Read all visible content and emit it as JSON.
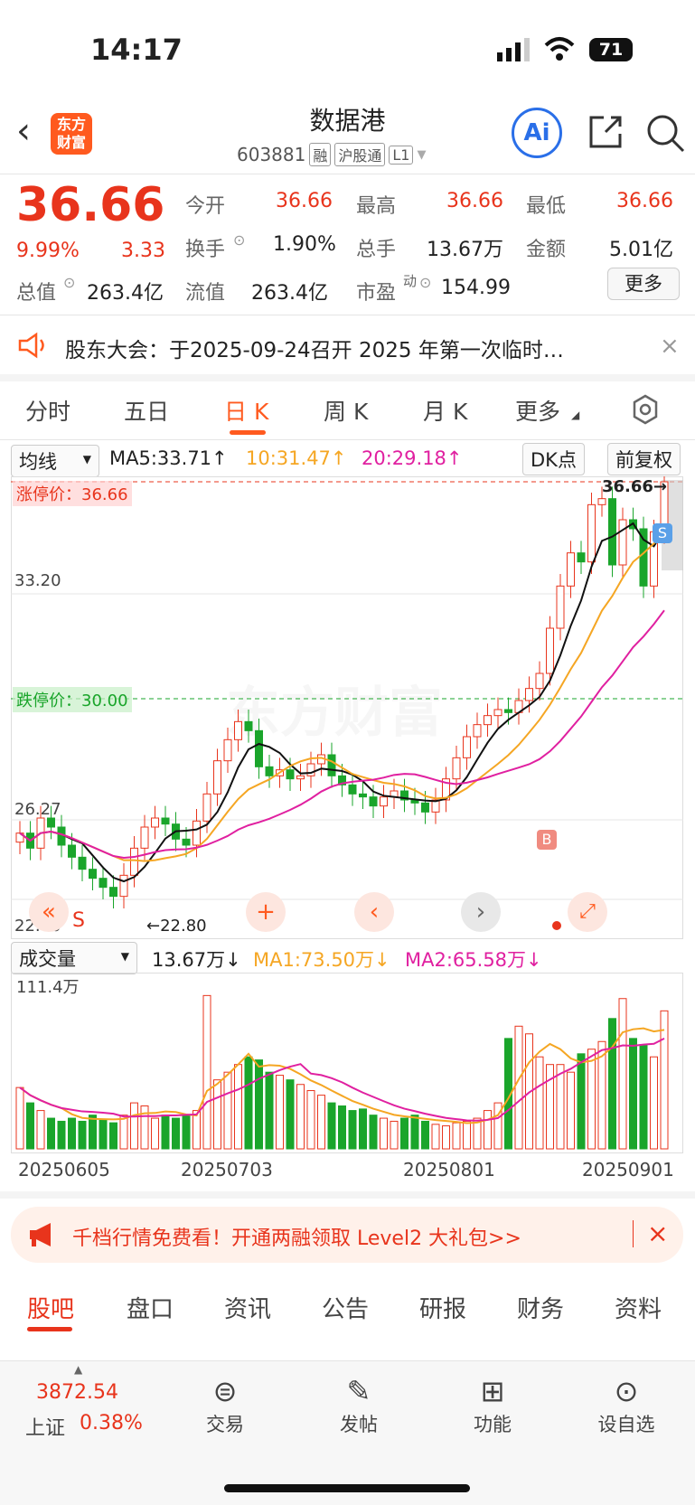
{
  "status": {
    "time": "14:17",
    "battery": "71"
  },
  "header": {
    "logo_line1": "东方",
    "logo_line2": "财富",
    "title": "数据港",
    "code": "603881",
    "tags": [
      "融",
      "沪股通",
      "L1"
    ],
    "ai": "Ai"
  },
  "quote": {
    "price": "36.66",
    "pct": "9.99%",
    "change": "3.33",
    "open_label": "今开",
    "open": "36.66",
    "high_label": "最高",
    "high": "36.66",
    "low_label": "最低",
    "low": "36.66",
    "turnover_label": "换手",
    "turnover": "1.90%",
    "volume_label": "总手",
    "volume": "13.67万",
    "amount_label": "金额",
    "amount": "5.01亿",
    "mktcap_label": "总值",
    "mktcap": "263.4亿",
    "float_label": "流值",
    "float": "263.4亿",
    "pe_label": "市盈",
    "pe_sup": "动",
    "pe": "154.99",
    "more": "更多"
  },
  "notice": {
    "text": "股东大会：于2025-09-24召开 2025 年第一次临时…"
  },
  "ktabs": [
    "分时",
    "五日",
    "日 K",
    "周 K",
    "月 K",
    "更多"
  ],
  "toolbar": {
    "ma_select": "均线",
    "ma5": "MA5:33.71↑",
    "ma10": "10:31.47↑",
    "ma20": "20:29.18↑",
    "dk": "DK点",
    "fq": "前复权"
  },
  "chart": {
    "upper_limit": "涨停价：36.66",
    "lower_limit": "跌停价：30.00",
    "y_top": "36.66",
    "y1": "33.20",
    "y2": "26.27",
    "y_bottom": "22.80",
    "last_price": "36.66→",
    "low_marker": "←22.80",
    "s_mark": "S",
    "b_mark": "B",
    "s_badge": "S",
    "watermark": "东方财富"
  },
  "volume": {
    "select": "成交量",
    "value": "13.67万↓",
    "ma1": "MA1:73.50万↓",
    "ma2": "MA2:65.58万↓",
    "ymax": "111.4万"
  },
  "dates": [
    "20250605",
    "20250703",
    "20250801",
    "20250901"
  ],
  "banner": {
    "text": "千档行情免费看！开通两融领取 Level2 大礼包>>"
  },
  "btabs": [
    "股吧",
    "盘口",
    "资讯",
    "公告",
    "研报",
    "财务",
    "资料"
  ],
  "nav": {
    "index_value": "3872.54",
    "index_name": "上证",
    "index_pct": "0.38%",
    "items": [
      "交易",
      "发帖",
      "功能",
      "设自选"
    ]
  },
  "colors": {
    "up": "#e8341c",
    "down": "#1aa52b",
    "accent": "#ff5a1f"
  }
}
